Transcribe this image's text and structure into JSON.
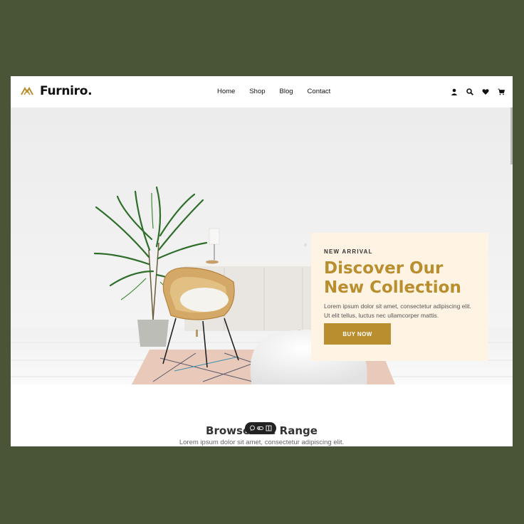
{
  "brand": {
    "name": "Furniro."
  },
  "nav": [
    "Home",
    "Shop",
    "Blog",
    "Contact"
  ],
  "header_icons": [
    "user-icon",
    "search-icon",
    "heart-icon",
    "cart-icon"
  ],
  "hero": {
    "eyebrow": "NEW ARRIVAL",
    "title_line1": "Discover Our",
    "title_line2": "New Collection",
    "text": "Lorem ipsum dolor sit amet, consectetur adipiscing elit. Ut elit tellus, luctus nec ullamcorper mattis.",
    "button": "BUY NOW"
  },
  "browse": {
    "title": "Browse The Range",
    "subtitle": "Lorem ipsum dolor sit amet, consectetur adipiscing elit."
  },
  "floating_toolbar_icons": [
    "comment-icon",
    "toggle-icon",
    "panel-icon"
  ],
  "colors": {
    "accent": "#B88E2F",
    "promo_bg": "#FFF3E3",
    "page_bg": "#4A5538"
  }
}
